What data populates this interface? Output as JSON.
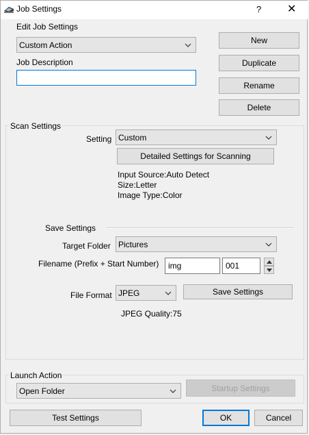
{
  "window": {
    "title": "Job Settings",
    "help_glyph": "?",
    "close_glyph": "✕",
    "icon": "printer-scanner-icon"
  },
  "edit_job": {
    "label": "Edit Job Settings",
    "selected_action": "Custom Action",
    "job_description_label": "Job Description",
    "job_description_value": ""
  },
  "job_buttons": {
    "new": "New",
    "duplicate": "Duplicate",
    "rename": "Rename",
    "delete": "Delete"
  },
  "scan_settings": {
    "group_label": "Scan Settings",
    "setting_label": "Setting",
    "setting_value": "Custom",
    "detailed_button": "Detailed Settings for Scanning",
    "info": [
      "Input Source:Auto Detect",
      "Size:Letter",
      "Image Type:Color"
    ]
  },
  "save_settings": {
    "section_label": "Save Settings",
    "target_folder_label": "Target Folder",
    "target_folder_value": "Pictures",
    "filename_label": "Filename (Prefix + Start Number)",
    "prefix_value": "img",
    "start_number_value": "001",
    "file_format_label": "File Format",
    "file_format_value": "JPEG",
    "save_settings_button": "Save Settings",
    "jpeg_quality": "JPEG Quality:75"
  },
  "launch_action": {
    "group_label": "Launch Action",
    "value": "Open Folder",
    "startup_button": "Startup Settings"
  },
  "footer": {
    "test": "Test Settings",
    "ok": "OK",
    "cancel": "Cancel"
  }
}
